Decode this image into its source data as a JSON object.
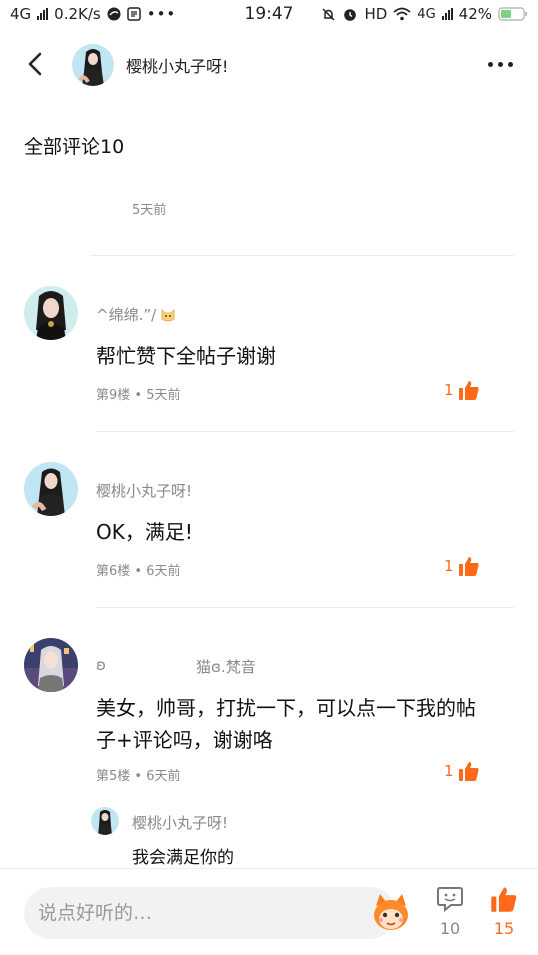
{
  "status_bar": {
    "network_left": "4G",
    "speed": "0.2K/s",
    "time": "19:47",
    "hd": "HD",
    "network_right": "4G",
    "battery": "42%"
  },
  "header": {
    "title": "樱桃小丸子呀!"
  },
  "comments_section": {
    "title": "全部评论10",
    "orphan_meta": "5天前"
  },
  "comments": [
    {
      "author": "^绵绵.”/",
      "text": "帮忙赞下全帖子谢谢",
      "floor": "第9楼",
      "time": "5天前",
      "likes": "1"
    },
    {
      "author": "樱桃小丸子呀!",
      "text": "OK，满足!",
      "floor": "第6楼",
      "time": "6天前",
      "likes": "1"
    },
    {
      "author_prefix": "ʚ",
      "author": "猫ɞ.梵音",
      "text": "美女，帅哥，打扰一下，可以点一下我的帖子+评论吗，谢谢咯",
      "floor": "第5楼",
      "time": "6天前",
      "likes": "1"
    }
  ],
  "reply": {
    "author": "樱桃小丸子呀!",
    "text": "我会满足你的"
  },
  "bottom_bar": {
    "input_placeholder": "说点好听的…",
    "comment_count": "10",
    "like_count": "15"
  },
  "meta_separator": "•",
  "colors": {
    "accent": "#ff6a1a",
    "meta_text": "#8a8a8a",
    "divider": "#ececec"
  }
}
